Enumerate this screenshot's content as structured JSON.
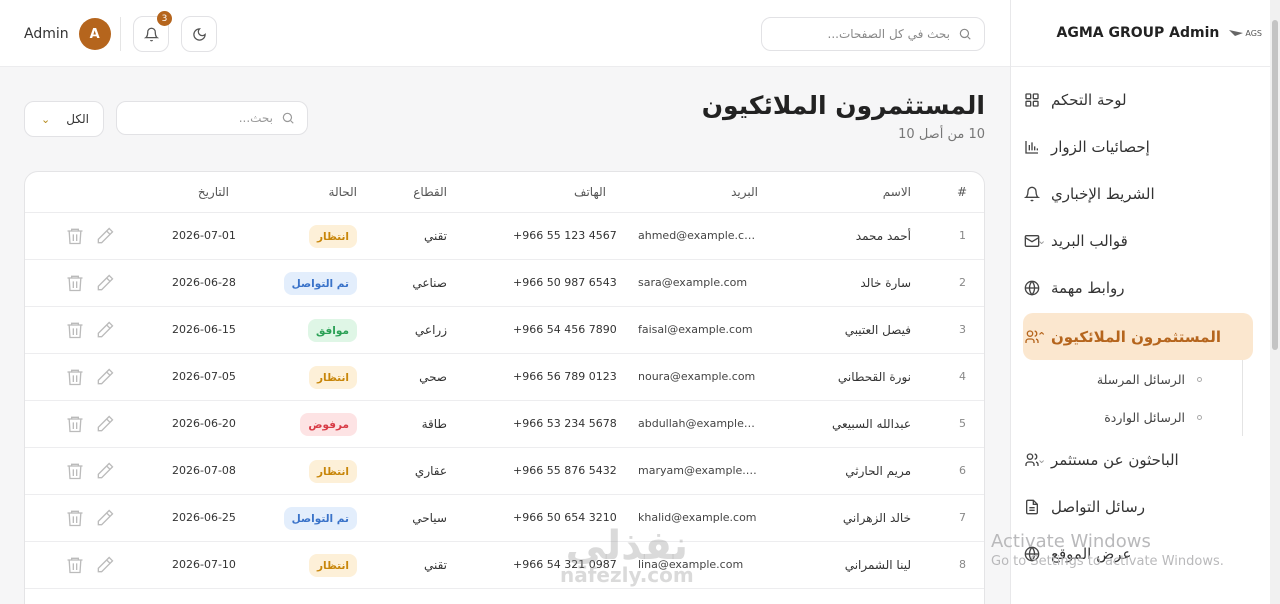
{
  "topbar": {
    "admin_label": "Admin",
    "avatar_letter": "A",
    "notifications_count": "3",
    "search_placeholder": "بحث في كل الصفحات..."
  },
  "sidebar": {
    "title": "AGMA GROUP Admin",
    "logo_text": "AGS",
    "items": [
      {
        "label": "لوحة التحكم",
        "icon": "grid-icon"
      },
      {
        "label": "إحصائيات الزوار",
        "icon": "bar-chart-icon"
      },
      {
        "label": "الشريط الإخباري",
        "icon": "bell-icon"
      },
      {
        "label": "قوالب البريد",
        "icon": "mail-icon"
      },
      {
        "label": "روابط مهمة",
        "icon": "globe-icon"
      },
      {
        "label": "المستثمرون الملائكيون",
        "icon": "users-icon"
      },
      {
        "label": "الباحثون عن مستثمر",
        "icon": "users-icon"
      },
      {
        "label": "رسائل التواصل",
        "icon": "document-icon"
      },
      {
        "label": "عرض الموقع",
        "icon": "globe-icon"
      }
    ],
    "subitems": [
      {
        "label": "الرسائل المرسلة"
      },
      {
        "label": "الرسائل الواردة"
      }
    ],
    "accent_color": "#b5651d",
    "active_bg": "#fbe7cf"
  },
  "page": {
    "title": "المستثمرون الملائكيون",
    "subtitle": "10 من أصل 10",
    "search_placeholder": "بحث...",
    "filter_value": "الكل"
  },
  "table": {
    "headers": {
      "index": "#",
      "name": "الاسم",
      "email": "البريد",
      "phone": "الهاتف",
      "sector": "القطاع",
      "status": "الحالة",
      "date": "التاريخ"
    },
    "rows": [
      {
        "index": "1",
        "name": "أحمد محمد",
        "email": "ahmed@example.com",
        "phone": "+966 55 123 4567",
        "sector": "تقني",
        "status": "انتظار",
        "status_type": "wait",
        "date": "2026-07-01"
      },
      {
        "index": "2",
        "name": "سارة خالد",
        "email": "sara@example.com",
        "phone": "+966 50 987 6543",
        "sector": "صناعي",
        "status": "تم التواصل",
        "status_type": "contact",
        "date": "2026-06-28"
      },
      {
        "index": "3",
        "name": "فيصل العتيبي",
        "email": "faisal@example.com",
        "phone": "+966 54 456 7890",
        "sector": "زراعي",
        "status": "موافق",
        "status_type": "ok",
        "date": "2026-06-15"
      },
      {
        "index": "4",
        "name": "نورة القحطاني",
        "email": "noura@example.com",
        "phone": "+966 56 789 0123",
        "sector": "صحي",
        "status": "انتظار",
        "status_type": "wait",
        "date": "2026-07-05"
      },
      {
        "index": "5",
        "name": "عبدالله السبيعي",
        "email": "abdullah@example.c...",
        "phone": "+966 53 234 5678",
        "sector": "طاقة",
        "status": "مرفوض",
        "status_type": "rej",
        "date": "2026-06-20"
      },
      {
        "index": "6",
        "name": "مريم الحارثي",
        "email": "maryam@example.c...",
        "phone": "+966 55 876 5432",
        "sector": "عقاري",
        "status": "انتظار",
        "status_type": "wait",
        "date": "2026-07-08"
      },
      {
        "index": "7",
        "name": "خالد الزهراني",
        "email": "khalid@example.com",
        "phone": "+966 50 654 3210",
        "sector": "سياحي",
        "status": "تم التواصل",
        "status_type": "contact",
        "date": "2026-06-25"
      },
      {
        "index": "8",
        "name": "لينا الشمراني",
        "email": "lina@example.com",
        "phone": "+966 54 321 0987",
        "sector": "تقني",
        "status": "انتظار",
        "status_type": "wait",
        "date": "2026-07-10"
      }
    ]
  },
  "watermarks": {
    "windows_line1": "Activate Windows",
    "windows_line2": "Go to Settings to activate Windows.",
    "site_ar": "نفذلي",
    "site_en": "nafezly.com"
  }
}
